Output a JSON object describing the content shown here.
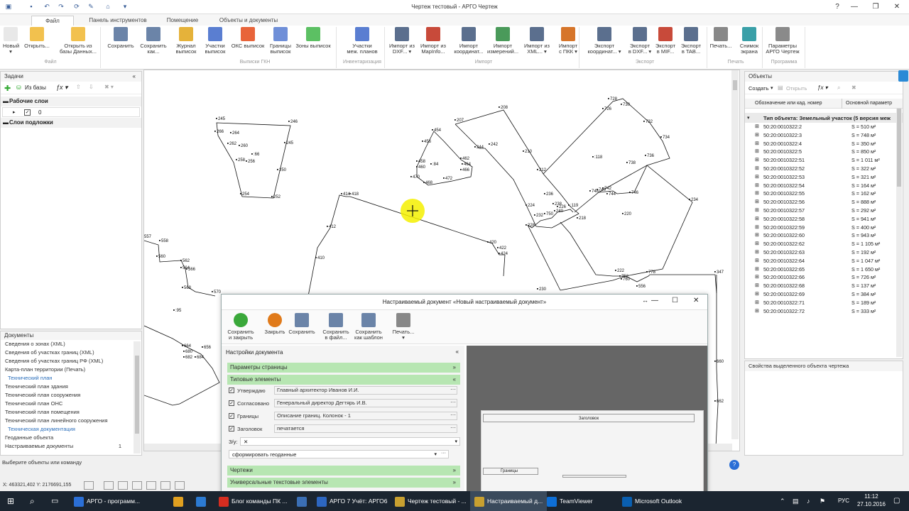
{
  "window": {
    "title": "Чертеж тестовый - АРГО Чертеж"
  },
  "tabs": [
    "Файл",
    "Панель инструментов",
    "Помещение",
    "Объекты и документы"
  ],
  "ribbon": {
    "buttons": [
      {
        "label": "Новый\n▾",
        "color": "#e8e8e8"
      },
      {
        "label": "Открыть...",
        "color": "#f2c14e"
      },
      {
        "label": "Открыть из\nбазы Данных...",
        "color": "#f2c14e"
      },
      {
        "label": "Сохранить",
        "color": "#6b84a8"
      },
      {
        "label": "Сохранить\nкак...",
        "color": "#6b84a8"
      },
      {
        "label": "Журнал\nвыписок",
        "color": "#e5b23a"
      },
      {
        "label": "Участки\nвыписок",
        "color": "#5a7ed1"
      },
      {
        "label": "ОКС выписок",
        "color": "#e8643a"
      },
      {
        "label": "Границы\nвыписок",
        "color": "#6f8fd8"
      },
      {
        "label": "Зоны выписок",
        "color": "#5cc063"
      },
      {
        "label": "Участки\nмеж. планов",
        "color": "#5a7ed1"
      },
      {
        "label": "Импорт из\nDXF... ▾",
        "color": "#5b6f8e"
      },
      {
        "label": "Импорт из\nMapInfo...",
        "color": "#c84a3a"
      },
      {
        "label": "Импорт\nкоординат...",
        "color": "#5b6f8e"
      },
      {
        "label": "Импорт\nизмерений...",
        "color": "#4a9a5a"
      },
      {
        "label": "Импорт из\nXML... ▾",
        "color": "#5b6f8e"
      },
      {
        "label": "Импорт\nс ПКК ▾",
        "color": "#d6752a"
      },
      {
        "label": "Экспорт\nкоординат... ▾",
        "color": "#5b6f8e"
      },
      {
        "label": "Экспорт\nв DXF... ▾",
        "color": "#5b6f8e"
      },
      {
        "label": "Экспорт\nв MIF...",
        "color": "#c84a3a"
      },
      {
        "label": "Экспорт\nв TAB...",
        "color": "#5b6f8e"
      },
      {
        "label": "Печать...",
        "color": "#888"
      },
      {
        "label": "Снимок\nэкрана",
        "color": "#3aa0a8"
      },
      {
        "label": "Параметры\nАРГО Чертеж",
        "color": "#8a8a8a"
      }
    ],
    "groups": [
      "Файл",
      "Выписки ГКН",
      "Инвентаризация",
      "Импорт",
      "Экспорт",
      "Печать",
      "Программа"
    ]
  },
  "tasks_panel": {
    "title": "Задачи",
    "from_db": "Из базы",
    "working_layers": "Рабочие слои",
    "layer_value": "0",
    "underlay_layers": "Слои подложки"
  },
  "docs_panel": {
    "title": "Документы",
    "items": [
      {
        "text": "Сведения о зонах (XML)",
        "hdr": false
      },
      {
        "text": "Сведения об участках границ (XML)",
        "hdr": false
      },
      {
        "text": "Сведения об участках границ РФ (XML)",
        "hdr": false
      },
      {
        "text": "Карта-план территории (Печать)",
        "hdr": false
      },
      {
        "text": "Технический план",
        "hdr": true
      },
      {
        "text": "Технический план здания",
        "hdr": false
      },
      {
        "text": "Технический план сооружения",
        "hdr": false
      },
      {
        "text": "Технический план ОНС",
        "hdr": false
      },
      {
        "text": "Технический план помещения",
        "hdr": false
      },
      {
        "text": "Технический план линейного сооружения",
        "hdr": false
      },
      {
        "text": "Техническая документация",
        "hdr": true
      },
      {
        "text": "Геоданные объекта",
        "hdr": false
      },
      {
        "text": "Настраиваемые документы",
        "hdr": false
      }
    ],
    "count": "1"
  },
  "status": {
    "prompt": "Выберите объекты или команду",
    "coords": "X: 463321,402 Y: 2176691,155"
  },
  "objects_panel": {
    "title": "Объекты",
    "create": "Создать",
    "open": "Открыть",
    "col1": "Обозначение или кад. номер",
    "col2": "Основной параметр",
    "group": "Тип объекта: Земельный участок (5 версия меж",
    "rows": [
      [
        "50:20:0010322:2",
        "S = 510 м²"
      ],
      [
        "50:20:0010322:3",
        "S = 748 м²"
      ],
      [
        "50:20:0010322:4",
        "S = 350 м²"
      ],
      [
        "50:20:0010322:5",
        "S = 850 м²"
      ],
      [
        "50:20:0010322:51",
        "S = 1 011 м²"
      ],
      [
        "50:20:0010322:52",
        "S = 322 м²"
      ],
      [
        "50:20:0010322:53",
        "S = 321 м²"
      ],
      [
        "50:20:0010322:54",
        "S = 164 м²"
      ],
      [
        "50:20:0010322:55",
        "S = 162 м²"
      ],
      [
        "50:20:0010322:56",
        "S = 888 м²"
      ],
      [
        "50:20:0010322:57",
        "S = 292 м²"
      ],
      [
        "50:20:0010322:58",
        "S = 941 м²"
      ],
      [
        "50:20:0010322:59",
        "S = 400 м²"
      ],
      [
        "50:20:0010322:60",
        "S = 943 м²"
      ],
      [
        "50:20:0010322:62",
        "S = 1 105 м²"
      ],
      [
        "50:20:0010322:63",
        "S = 192 м²"
      ],
      [
        "50:20:0010322:64",
        "S = 1 047 м²"
      ],
      [
        "50:20:0010322:65",
        "S = 1 650 м²"
      ],
      [
        "50:20:0010322:66",
        "S = 726 м²"
      ],
      [
        "50:20:0010322:68",
        "S = 137 м²"
      ],
      [
        "50:20:0010322:69",
        "S = 384 м²"
      ],
      [
        "50:20:0010322:71",
        "S = 189 м²"
      ],
      [
        "50:20:0010322:72",
        "S = 333 м²"
      ]
    ]
  },
  "properties_panel": {
    "title": "Свойства выделенного объекта чертежа"
  },
  "canvas_labels": [
    "245",
    "246",
    "266",
    "264",
    "262",
    "260",
    ":66",
    "258",
    "256",
    "245",
    "250",
    "254",
    "252",
    "557",
    "558",
    "560",
    "562",
    "564",
    "566",
    "568",
    "570",
    ":95",
    "412",
    "410",
    "414",
    "418",
    "420",
    "422",
    "424",
    "454",
    "456",
    "458",
    "460",
    "462",
    "464",
    ":84",
    "466",
    "468",
    "470",
    "472",
    "207",
    "208",
    "244",
    "242",
    "210",
    "212",
    "728",
    "726",
    "730",
    "732",
    "734",
    "736",
    ":118",
    "738",
    "740",
    "742",
    "744",
    "746",
    "748",
    "234",
    "236",
    "238",
    "240",
    "226",
    "224",
    "228",
    "230",
    "232",
    "750",
    ":119",
    "218",
    "220",
    "222",
    "760",
    "752",
    "778",
    "556",
    "347",
    "660",
    "662",
    "664",
    "680",
    "682",
    "684",
    "656"
  ],
  "dialog": {
    "title": "Настраиваемый документ «Новый настраиваемый документ»",
    "toolbar": [
      "Сохранить\nи закрыть",
      "Закрыть",
      "Сохранить",
      "Сохранить\nв файл...",
      "Сохранить\nкак шаблон",
      "Печать...\n▾"
    ],
    "settings_title": "Настройки документа",
    "page_params": "Параметры страницы",
    "typical": "Типовые элементы",
    "fields": [
      {
        "label": "Утверждаю",
        "value": "Главный архитектор Иванов И.И."
      },
      {
        "label": "Согласовано",
        "value": "Генеральный директор Дегтярь И.В."
      },
      {
        "label": "Границы",
        "value": "Описание границ. Колонок - 1"
      },
      {
        "label": "Заголовок",
        "value": "печатается"
      }
    ],
    "zu_label": "З/у:",
    "zu_value": "✕",
    "geo_select": "сформировать геоданные",
    "drawings": "Чертежи",
    "universal": "Универсальные текстовые элементы",
    "preview_label": "Границы",
    "preview_header": "Заголовок"
  },
  "taskbar": {
    "items": [
      {
        "label": "АРГО - программ...",
        "color": "#2b6fd6"
      },
      {
        "label": "",
        "color": "#e0a020"
      },
      {
        "label": "",
        "color": "#2c7bd3"
      },
      {
        "label": "",
        "color": "#444"
      },
      {
        "label": "Блог команды ПК ...",
        "color": "#d62d20"
      },
      {
        "label": "",
        "color": "#3b6fb5"
      },
      {
        "label": "АРГО 7 Учёт: АРГО6",
        "color": "#2d66c0"
      },
      {
        "label": "Чертеж тестовый - ...",
        "color": "#c8a030"
      },
      {
        "label": "Настраиваемый д...",
        "color": "#c8a030"
      },
      {
        "label": "TeamViewer",
        "color": "#0e6fd6"
      },
      {
        "label": "Microsoft Outlook",
        "color": "#0a5fb0"
      }
    ],
    "lang": "РУС",
    "time": "11:12",
    "date": "27.10.2016"
  }
}
